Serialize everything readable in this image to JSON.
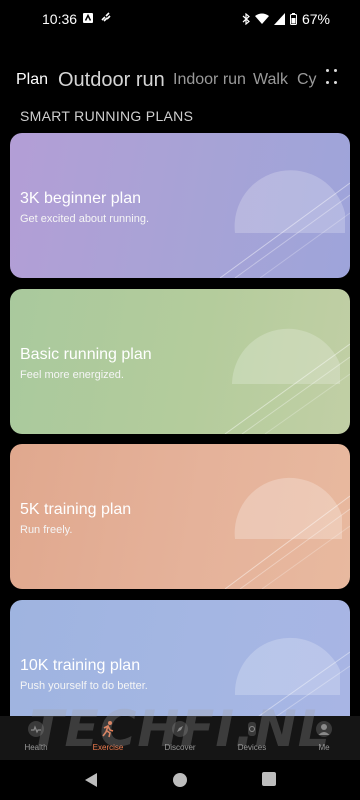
{
  "status": {
    "time": "10:36",
    "battery": "67%",
    "left_icons": [
      "app-notification-icon",
      "link-icon"
    ],
    "right_icons": [
      "bluetooth-icon",
      "wifi-icon",
      "signal-icon",
      "battery-icon"
    ]
  },
  "tabs": [
    {
      "label": "Plan"
    },
    {
      "label": "Outdoor run"
    },
    {
      "label": "Indoor run"
    },
    {
      "label": "Walk"
    },
    {
      "label": "Cy"
    }
  ],
  "section_title": "SMART RUNNING PLANS",
  "plans": [
    {
      "title": "3K beginner plan",
      "subtitle": "Get excited about running."
    },
    {
      "title": "Basic running plan",
      "subtitle": "Feel more energized."
    },
    {
      "title": "5K training plan",
      "subtitle": "Run freely."
    },
    {
      "title": "10K training plan",
      "subtitle": "Push yourself to do better."
    }
  ],
  "bottom_nav": [
    {
      "label": "Health",
      "icon": "health-icon",
      "active": false
    },
    {
      "label": "Exercise",
      "icon": "exercise-icon",
      "active": true
    },
    {
      "label": "Discover",
      "icon": "discover-icon",
      "active": false
    },
    {
      "label": "Devices",
      "icon": "devices-icon",
      "active": false
    },
    {
      "label": "Me",
      "icon": "profile-icon",
      "active": false
    }
  ],
  "watermark": "TECHFI.NL",
  "colors": {
    "accent": "#f07c4e",
    "card_purple": "#ab9fd6",
    "card_green": "#b4cc9c",
    "card_orange": "#e5b29a",
    "card_blue": "#a4b6e3"
  }
}
